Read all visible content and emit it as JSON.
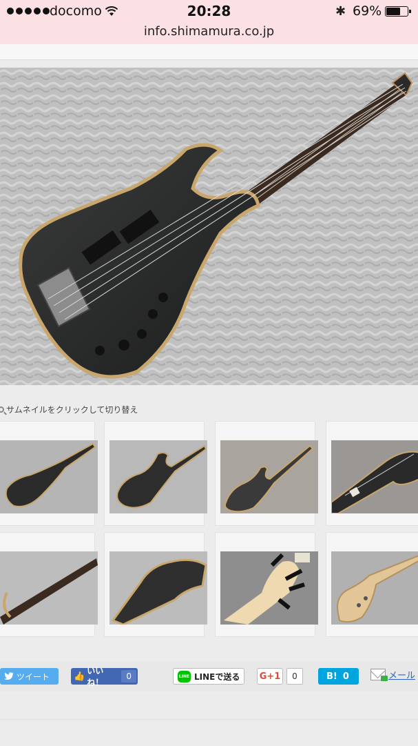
{
  "status_bar": {
    "carrier": "docomo",
    "time": "20:28",
    "battery_percent": "69%",
    "battery_level": 0.69,
    "url": "info.shimamura.co.jp"
  },
  "gallery": {
    "hint": "サムネイルをクリックして切り替え",
    "thumbnails": [
      {
        "name": "thumb-bass-full-1"
      },
      {
        "name": "thumb-bass-full-2"
      },
      {
        "name": "thumb-bass-full-3"
      },
      {
        "name": "thumb-headstock"
      },
      {
        "name": "thumb-neck-closeup"
      },
      {
        "name": "thumb-body-back"
      },
      {
        "name": "thumb-headstock-back"
      },
      {
        "name": "thumb-body-natural"
      }
    ]
  },
  "share": {
    "tweet_label": "ツイート",
    "like_label": "いいね！",
    "like_count": "0",
    "line_label": "LINEで送る",
    "line_icon_text": "LINE",
    "gplus_label": "G+1",
    "gplus_count": "0",
    "hatena_label": "B!",
    "hatena_count": "0",
    "mail_label": "メール"
  },
  "colors": {
    "status_bar_bg": "#fbe1e4",
    "tweet": "#55acee",
    "facebook": "#4267b2",
    "line": "#00c300",
    "hatena": "#00a4de"
  }
}
